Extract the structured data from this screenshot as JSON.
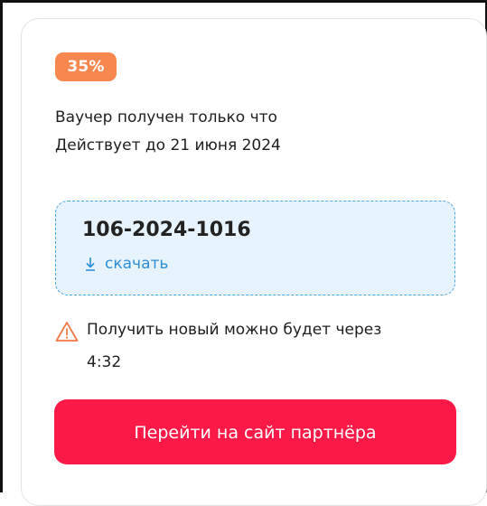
{
  "voucher_card": {
    "discount_badge": "35%",
    "status_text": "Ваучер получен только что",
    "valid_until_text": "Действует до 21 июня 2024",
    "voucher_code": "106-2024-1016",
    "download_label": "скачать",
    "warning_text": "Получить новый можно будет через",
    "cooldown_timer": "4:32",
    "partner_button_label": "Перейти на сайт партнёра"
  },
  "icons": {
    "download": "download-icon",
    "warning": "warning-triangle-icon"
  },
  "colors": {
    "badge_bg": "#f6874f",
    "button_bg": "#fb1a47",
    "link": "#2c8fd6",
    "voucher_box_bg": "#e6f3fc",
    "voucher_box_border": "#4aa3dc",
    "warning_icon": "#f07a45"
  }
}
